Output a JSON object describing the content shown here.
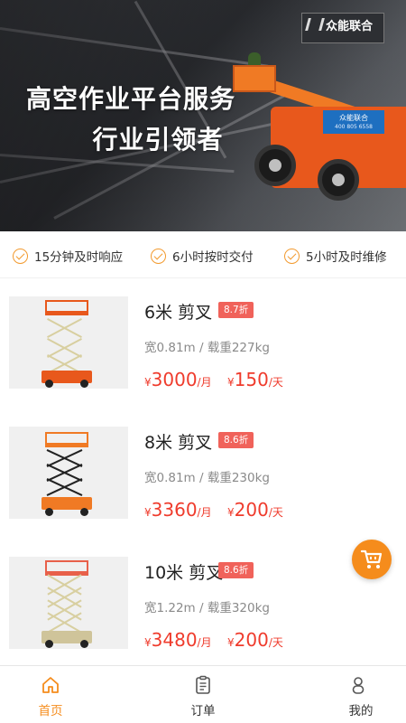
{
  "banner": {
    "headline_line1": "高空作业平台服务",
    "headline_line2": "行业引领者",
    "sign_name": "众能联合",
    "machine_label": "众能联合",
    "machine_phone": "400 805 6558"
  },
  "features": [
    {
      "label": "15分钟及时响应",
      "icon": "check-circle-icon"
    },
    {
      "label": "6小时按时交付",
      "icon": "check-circle-icon"
    },
    {
      "label": "5小时及时维修",
      "icon": "check-circle-icon"
    }
  ],
  "products": [
    {
      "name": "6米 剪叉",
      "discount": "8.7折",
      "spec": "宽0.81m / 载重227kg",
      "month_currency": "¥",
      "month_price": "3000",
      "month_unit": "/月",
      "day_currency": "¥",
      "day_price": "150",
      "day_unit": "/天"
    },
    {
      "name": "8米 剪叉",
      "discount": "8.6折",
      "spec": "宽0.81m / 载重230kg",
      "month_currency": "¥",
      "month_price": "3360",
      "month_unit": "/月",
      "day_currency": "¥",
      "day_price": "200",
      "day_unit": "/天"
    },
    {
      "name": "10米 剪叉",
      "discount": "8.6折",
      "spec": "宽1.22m / 载重320kg",
      "month_currency": "¥",
      "month_price": "3480",
      "month_unit": "/月",
      "day_currency": "¥",
      "day_price": "200",
      "day_unit": "/天"
    }
  ],
  "cart": {
    "icon": "shopping-cart-icon"
  },
  "tabbar": [
    {
      "label": "首页",
      "icon": "home-icon",
      "active": true
    },
    {
      "label": "订单",
      "icon": "clipboard-icon",
      "active": false
    },
    {
      "label": "我的",
      "icon": "user-icon",
      "active": false
    }
  ],
  "colors": {
    "accent": "#f58c1c",
    "price": "#ef3b2c",
    "discount_bg": "#f0625a",
    "check": "#f29a2e"
  }
}
